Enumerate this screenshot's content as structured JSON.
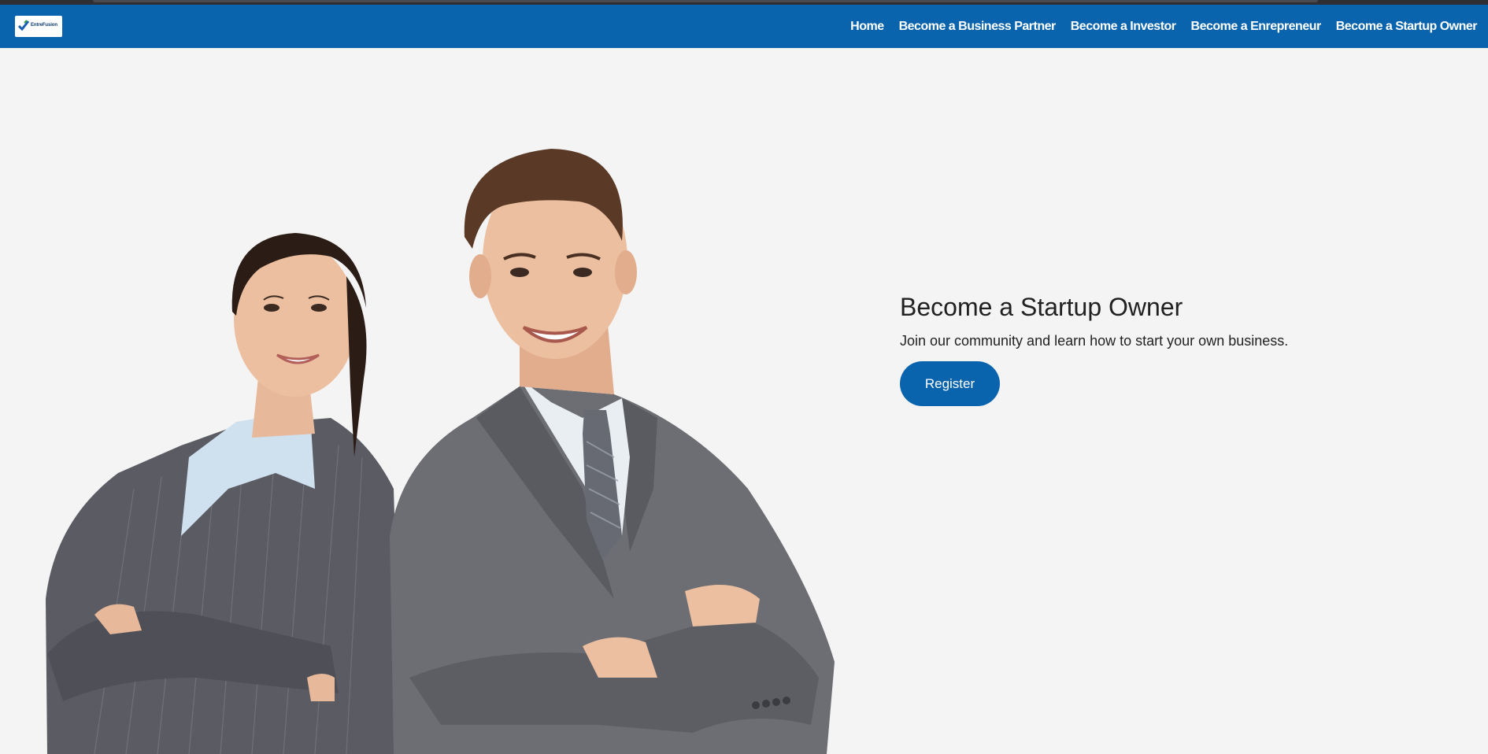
{
  "header": {
    "logo_text": "EntreFusion",
    "nav": [
      {
        "label": "Home"
      },
      {
        "label": "Become a Business Partner"
      },
      {
        "label": "Become a Investor"
      },
      {
        "label": "Become a Enrepreneur"
      },
      {
        "label": "Become a Startup Owner"
      }
    ]
  },
  "hero": {
    "title": "Become a Startup Owner",
    "subtitle": "Join our community and learn how to start your own business.",
    "button_label": "Register",
    "image_icon": "two-business-people-photo"
  },
  "colors": {
    "brand_blue": "#0a64ad",
    "background": "#f4f4f4",
    "text": "#212121"
  }
}
